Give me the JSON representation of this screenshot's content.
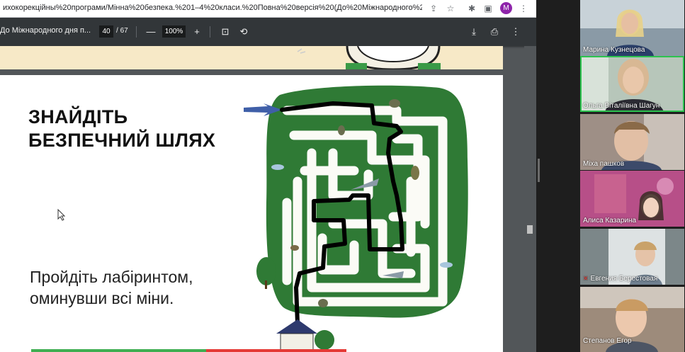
{
  "browser": {
    "url": "ихокорекційны%20програми/Мінна%20безпека.%201–4%20класи.%20Повна%20версія%20(До%20Міжнародного%20дня...",
    "colors": {
      "accent": "#8e24aa"
    },
    "avatar_letter": "M",
    "icons": [
      "share-icon",
      "star-icon",
      "extensions-icon",
      "sidebar-icon",
      "profile-icon",
      "menu-dots-icon"
    ]
  },
  "pdf_toolbar": {
    "title": "До Міжнародного дня п...",
    "current_page": "40",
    "page_separator": "/",
    "total_pages": "67",
    "zoom": "100%",
    "zoom_out": "—",
    "zoom_in": "+",
    "icons": [
      "fit-page-icon",
      "rotate-icon",
      "download-icon",
      "print-icon",
      "more-icon"
    ]
  },
  "pdf_page": {
    "heading_line1": "ЗНАЙДІТЬ",
    "heading_line2": "БЕЗПЕЧНИЙ ШЛЯХ",
    "instruction_line1": "Пройдіть лабіринтом,",
    "instruction_line2": "оминувши всі міни.",
    "colors": {
      "maze_green": "#2f7a35",
      "path_white": "#fbfbf6",
      "arrow_blue": "#3f5fa8",
      "drawn_line": "#000000"
    }
  },
  "participants": [
    {
      "name": "Марина Кузнецова",
      "bg": "#8a9aa6",
      "active": false,
      "muted": false
    },
    {
      "name": "Ольга Віталіївна Шагун",
      "bg": "#b7c6ba",
      "active": true,
      "muted": false
    },
    {
      "name": "Міха пашков",
      "bg": "#9e8f86",
      "active": false,
      "muted": false
    },
    {
      "name": "Алиса Казарина",
      "bg": "#b74f88",
      "active": false,
      "muted": false
    },
    {
      "name": "Евгения Берестовая",
      "bg": "#7c8789",
      "active": false,
      "muted": true
    },
    {
      "name": "Степанов Егор",
      "bg": "#9d8b7b",
      "active": false,
      "muted": false
    }
  ]
}
